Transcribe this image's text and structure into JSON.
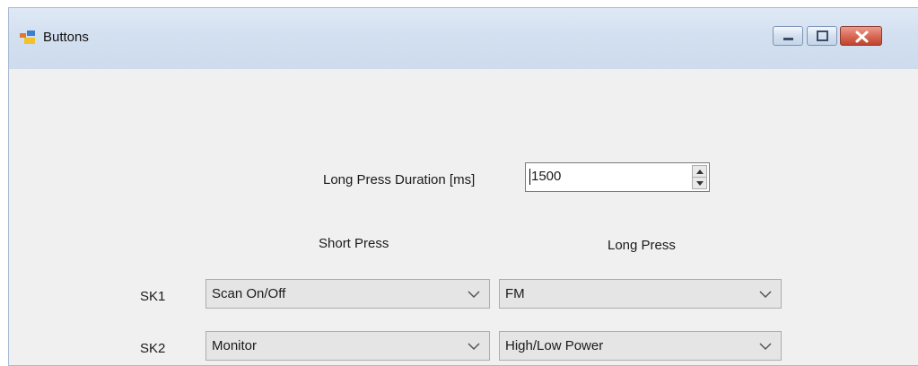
{
  "window": {
    "title": "Buttons",
    "icons": {
      "app": "app-icon",
      "minimize": "minimize-icon",
      "maximize": "maximize-icon",
      "close": "close-icon"
    }
  },
  "duration": {
    "label": "Long Press Duration [ms]",
    "value": "1500"
  },
  "columns": {
    "short_press": "Short Press",
    "long_press": "Long Press"
  },
  "rows": [
    {
      "key": "SK1",
      "short": "Scan On/Off",
      "long": "FM"
    },
    {
      "key": "SK2",
      "short": "Monitor",
      "long": "High/Low Power"
    }
  ],
  "colors": {
    "titlebar": "#d3e0f0",
    "client": "#f0f0f0",
    "close": "#d96b57"
  }
}
